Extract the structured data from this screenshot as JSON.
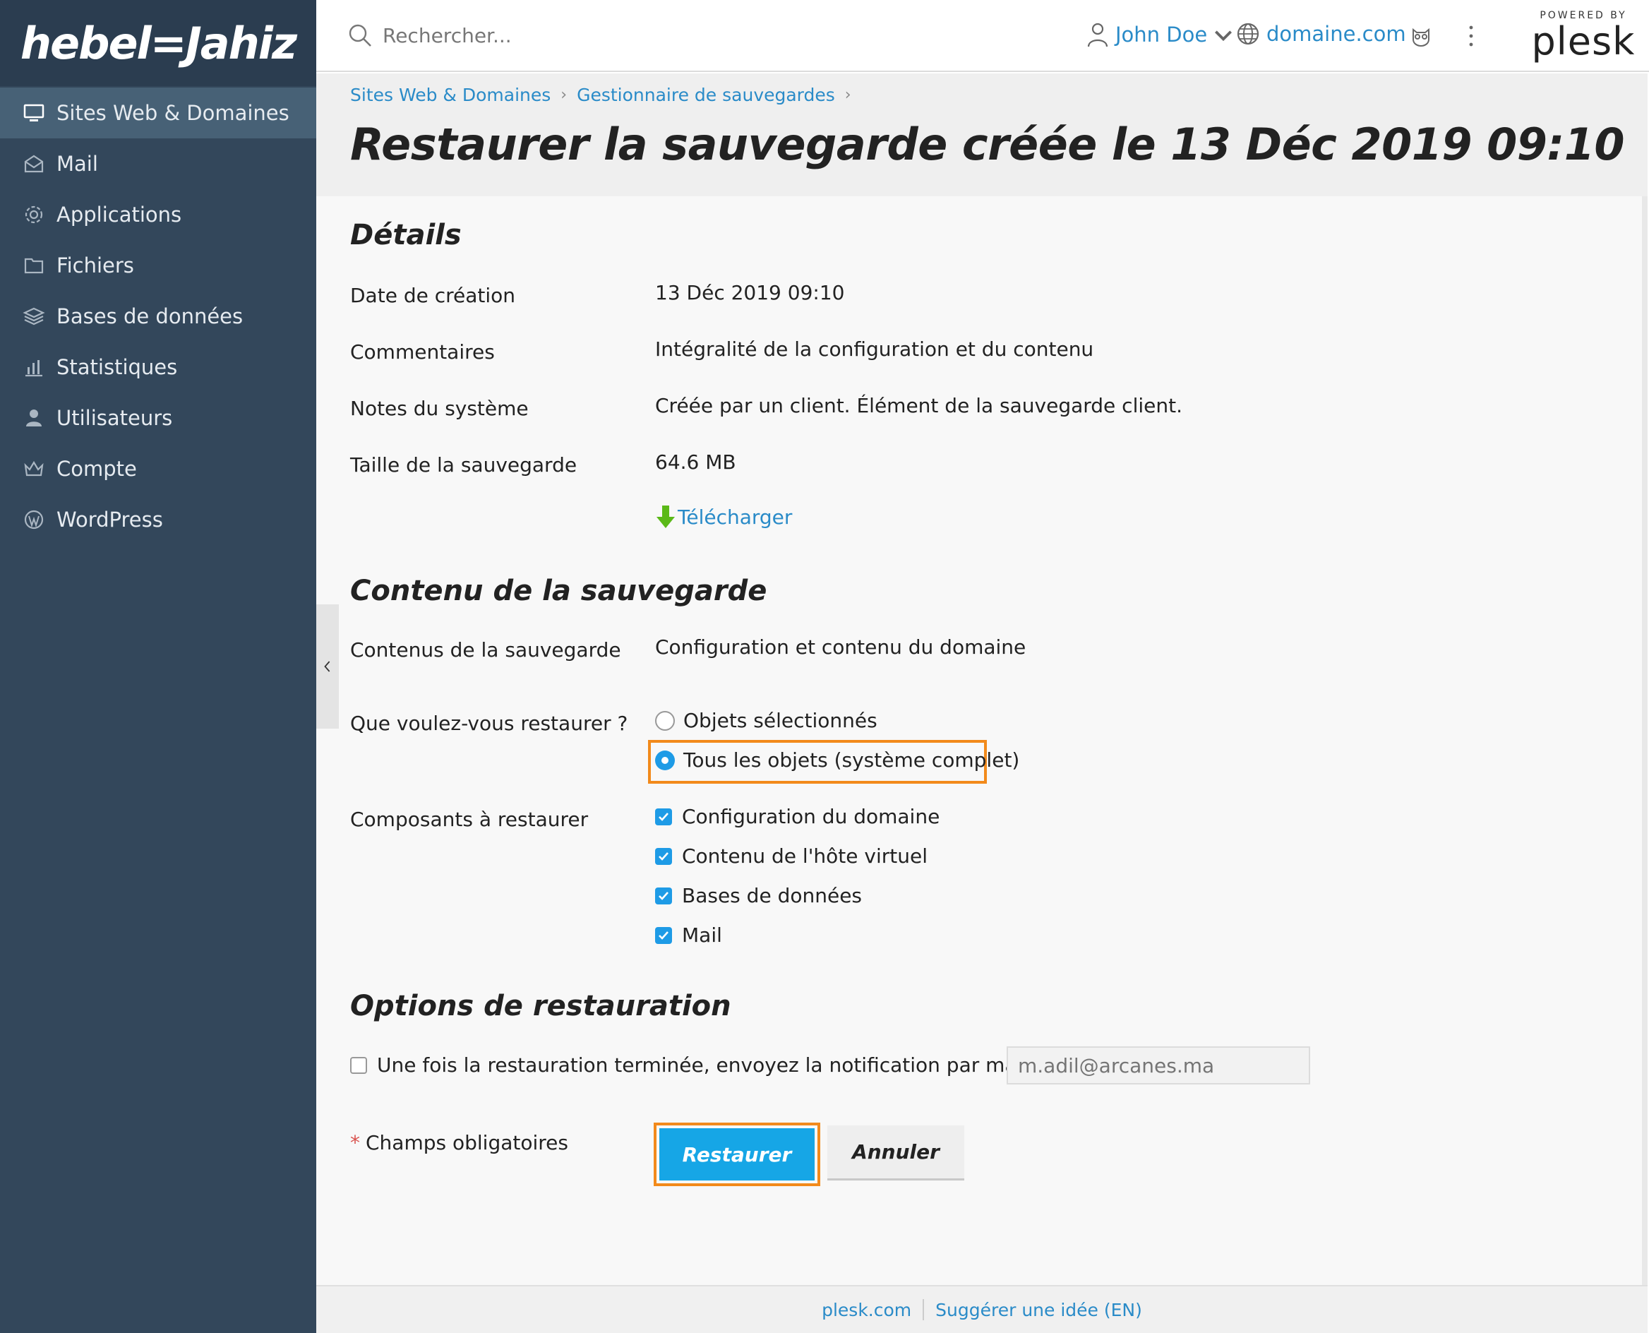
{
  "brand": {
    "logo_text": "hebel=Jahiz"
  },
  "sidebar": {
    "items": [
      {
        "label": "Sites Web & Domaines",
        "icon": "monitor-icon",
        "active": true
      },
      {
        "label": "Mail",
        "icon": "mail-icon"
      },
      {
        "label": "Applications",
        "icon": "gear-icon"
      },
      {
        "label": "Fichiers",
        "icon": "folder-icon"
      },
      {
        "label": "Bases de données",
        "icon": "database-icon"
      },
      {
        "label": "Statistiques",
        "icon": "chart-icon"
      },
      {
        "label": "Utilisateurs",
        "icon": "user-icon"
      },
      {
        "label": "Compte",
        "icon": "crown-icon"
      },
      {
        "label": "WordPress",
        "icon": "wordpress-icon"
      }
    ]
  },
  "topbar": {
    "search_placeholder": "Rechercher...",
    "user_name": "John Doe",
    "domain": "domaine.com",
    "powered_by": "POWERED BY",
    "plesk": "plesk"
  },
  "breadcrumb": [
    "Sites Web & Domaines",
    "Gestionnaire de sauvegardes"
  ],
  "page_title": "Restaurer la sauvegarde créée le 13 Déc 2019 09:10",
  "details": {
    "title": "Détails",
    "rows": [
      {
        "label": "Date de création",
        "value": "13 Déc 2019 09:10"
      },
      {
        "label": "Commentaires",
        "value": "Intégralité de la configuration et du contenu"
      },
      {
        "label": "Notes du système",
        "value": "Créée par un client. Élément de la sauvegarde client."
      },
      {
        "label": "Taille de la sauvegarde",
        "value": "64.6 MB"
      }
    ],
    "download": "Télécharger"
  },
  "contents": {
    "title": "Contenu de la sauvegarde",
    "contents_label": "Contenus de la sauvegarde",
    "contents_value": "Configuration et contenu du domaine",
    "restore_label": "Que voulez-vous restaurer ?",
    "options": [
      "Objets sélectionnés",
      "Tous les objets (système complet)"
    ],
    "selected_option": 1,
    "components_label": "Composants à restaurer",
    "components": [
      "Configuration du domaine",
      "Contenu de l'hôte virtuel",
      "Bases de données",
      "Mail"
    ]
  },
  "restore_options": {
    "title": "Options de restauration",
    "notify_label": "Une fois la restauration terminée, envoyez la notification par mail à",
    "notify_checked": false,
    "email_placeholder": "m.adil@arcanes.ma"
  },
  "form": {
    "required_label": "Champs obligatoires",
    "restore_button": "Restaurer",
    "cancel_button": "Annuler"
  },
  "footer": {
    "link1": "plesk.com",
    "link2": "Suggérer une idée (EN)"
  },
  "colors": {
    "accent": "#16a6e6",
    "link": "#2a8bc8",
    "highlight": "#f28a1b",
    "sidebar": "#33475b"
  }
}
